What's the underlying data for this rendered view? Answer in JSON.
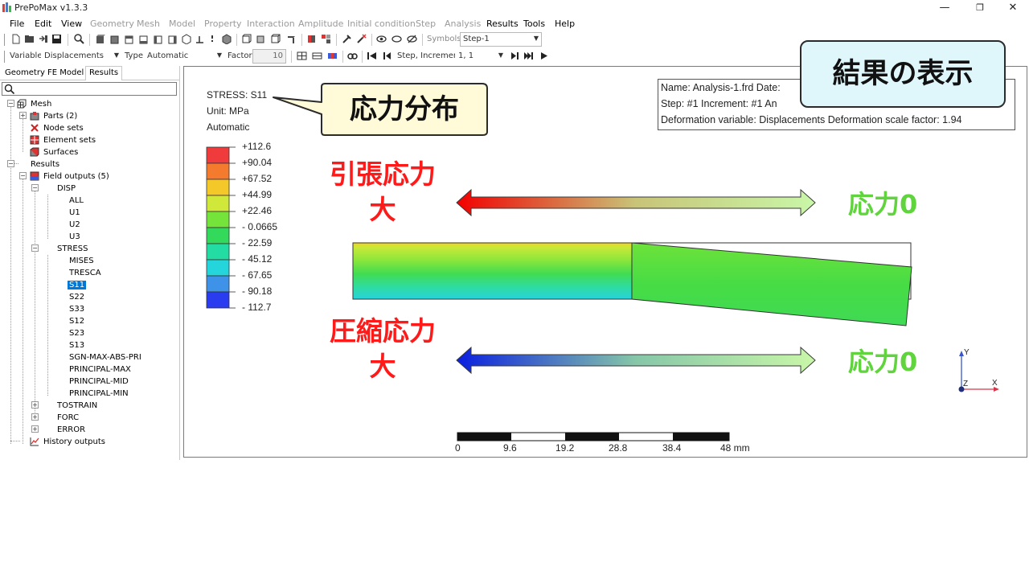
{
  "window": {
    "title": "PrePoMax v1.3.3",
    "minimize": "—",
    "maximize": "❐",
    "close": "✕"
  },
  "menu": {
    "items": [
      {
        "label": "File",
        "enabled": true
      },
      {
        "label": "Edit",
        "enabled": true
      },
      {
        "label": "View",
        "enabled": true
      },
      {
        "label": "Geometry",
        "enabled": false
      },
      {
        "label": "Mesh",
        "enabled": false
      },
      {
        "label": "Model",
        "enabled": false
      },
      {
        "label": "Property",
        "enabled": false
      },
      {
        "label": "Interaction",
        "enabled": false
      },
      {
        "label": "Amplitude",
        "enabled": false
      },
      {
        "label": "Initial condition",
        "enabled": false
      },
      {
        "label": "Step",
        "enabled": false
      },
      {
        "label": "Analysis",
        "enabled": false
      },
      {
        "label": "Results",
        "enabled": true
      },
      {
        "label": "Tools",
        "enabled": true
      },
      {
        "label": "Help",
        "enabled": true
      }
    ]
  },
  "toolbar1": {
    "symbols_label": "Symbols",
    "symbols_value": "Step-1"
  },
  "toolbar2": {
    "variable_label": "Variable",
    "variable_value": "Displacements",
    "type_label": "Type",
    "type_value": "Automatic",
    "factor_label": "Factor",
    "factor_value": "10",
    "step_increment_label": "Step, Increment",
    "step_increment_value": "1, 1"
  },
  "tabs": [
    "Geometry",
    "FE Model",
    "Results"
  ],
  "tree": {
    "mesh": "Mesh",
    "parts": "Parts (2)",
    "node_sets": "Node sets",
    "element_sets": "Element sets",
    "surfaces": "Surfaces",
    "results": "Results",
    "field_outputs": "Field outputs (5)",
    "disp": "DISP",
    "disp_items": [
      "ALL",
      "U1",
      "U2",
      "U3"
    ],
    "stress": "STRESS",
    "stress_items": [
      "MISES",
      "TRESCA",
      "S11",
      "S22",
      "S33",
      "S12",
      "S23",
      "S13",
      "SGN-MAX-ABS-PRI",
      "PRINCIPAL-MAX",
      "PRINCIPAL-MID",
      "PRINCIPAL-MIN"
    ],
    "selected": "S11",
    "tostrain": "TOSTRAIN",
    "forc": "FORC",
    "error": "ERROR",
    "history_outputs": "History outputs"
  },
  "legend": {
    "title": "STRESS: S11",
    "unit": "Unit: MPa",
    "mode": "Automatic",
    "colors": [
      "#ef3b3b",
      "#f47b2e",
      "#f5c82a",
      "#cfe83a",
      "#74e33a",
      "#33d95a",
      "#22dca4",
      "#24d6dc",
      "#3e92e8",
      "#2a3cef"
    ],
    "labels": [
      "+112.6",
      "+90.04",
      "+67.52",
      "+44.99",
      "+22.46",
      "- 0.0665",
      "- 22.59",
      "- 45.12",
      "- 67.65",
      "- 90.18",
      "- 112.7"
    ]
  },
  "info": {
    "line1": "Name: Analysis-1.frd   Date:",
    "line2": "Step: #1   Increment: #1   An",
    "line3": "Deformation variable: Displacements   Deformation scale factor: 1.94"
  },
  "annotations": {
    "title_box": "結果の表示",
    "stress_callout": "応力分布",
    "tension_line1": "引張応力",
    "tension_line2": "大",
    "compression_line1": "圧縮応力",
    "compression_line2": "大",
    "zero_top": "応力0",
    "zero_bottom": "応力0"
  },
  "scale_bar": {
    "ticks": [
      "0",
      "9.6",
      "19.2",
      "28.8",
      "38.4",
      "48 mm"
    ]
  },
  "axes": {
    "y": "Y",
    "z": "Z",
    "x": "X"
  },
  "colors": {
    "selection": "#0078d7",
    "tension_red": "#ff1a1a",
    "zero_green": "#5fd43c",
    "compression_blue": "#0a1fe0",
    "callout_fill_light_blue": "#dff7fb",
    "callout_fill_cream": "#fffbd9"
  }
}
